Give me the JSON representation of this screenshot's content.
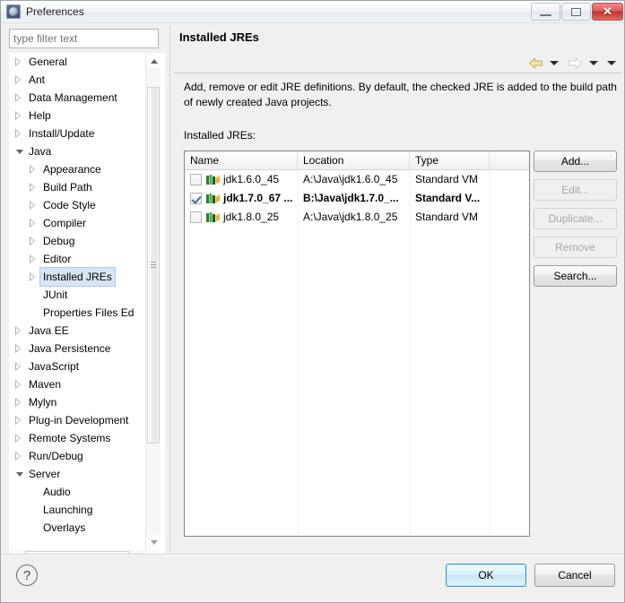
{
  "window": {
    "title": "Preferences",
    "icon": "preferences-app-icon",
    "controls": {
      "minimize": "minimize-button",
      "maximize": "maximize-button",
      "close_glyph": "✕"
    }
  },
  "filter": {
    "placeholder": "type filter text",
    "value": ""
  },
  "tree": {
    "items": [
      {
        "label": "General",
        "indent": 0,
        "state": "collapsed"
      },
      {
        "label": "Ant",
        "indent": 0,
        "state": "collapsed"
      },
      {
        "label": "Data Management",
        "indent": 0,
        "state": "collapsed"
      },
      {
        "label": "Help",
        "indent": 0,
        "state": "collapsed"
      },
      {
        "label": "Install/Update",
        "indent": 0,
        "state": "collapsed"
      },
      {
        "label": "Java",
        "indent": 0,
        "state": "expanded"
      },
      {
        "label": "Appearance",
        "indent": 1,
        "state": "collapsed"
      },
      {
        "label": "Build Path",
        "indent": 1,
        "state": "collapsed"
      },
      {
        "label": "Code Style",
        "indent": 1,
        "state": "collapsed"
      },
      {
        "label": "Compiler",
        "indent": 1,
        "state": "collapsed"
      },
      {
        "label": "Debug",
        "indent": 1,
        "state": "collapsed"
      },
      {
        "label": "Editor",
        "indent": 1,
        "state": "collapsed"
      },
      {
        "label": "Installed JREs",
        "indent": 1,
        "state": "collapsed",
        "selected": true
      },
      {
        "label": "JUnit",
        "indent": 1,
        "state": "leaf"
      },
      {
        "label": "Properties Files Ed",
        "indent": 1,
        "state": "leaf"
      },
      {
        "label": "Java EE",
        "indent": 0,
        "state": "collapsed"
      },
      {
        "label": "Java Persistence",
        "indent": 0,
        "state": "collapsed"
      },
      {
        "label": "JavaScript",
        "indent": 0,
        "state": "collapsed"
      },
      {
        "label": "Maven",
        "indent": 0,
        "state": "collapsed"
      },
      {
        "label": "Mylyn",
        "indent": 0,
        "state": "collapsed"
      },
      {
        "label": "Plug-in Development",
        "indent": 0,
        "state": "collapsed"
      },
      {
        "label": "Remote Systems",
        "indent": 0,
        "state": "collapsed"
      },
      {
        "label": "Run/Debug",
        "indent": 0,
        "state": "collapsed"
      },
      {
        "label": "Server",
        "indent": 0,
        "state": "expanded"
      },
      {
        "label": "Audio",
        "indent": 1,
        "state": "leaf"
      },
      {
        "label": "Launching",
        "indent": 1,
        "state": "leaf"
      },
      {
        "label": "Overlays",
        "indent": 1,
        "state": "leaf"
      }
    ]
  },
  "pane": {
    "title": "Installed JREs",
    "description": "Add, remove or edit JRE definitions. By default, the checked JRE is added to the build path of newly created Java projects.",
    "table_label": "Installed JREs:",
    "nav": {
      "back_icon": "arrow-left-icon",
      "back_menu_icon": "chevron-down-icon",
      "forward_icon": "arrow-right-icon",
      "forward_menu_icon": "chevron-down-icon",
      "more_menu_icon": "chevron-down-icon"
    }
  },
  "table": {
    "columns": [
      "Name",
      "Location",
      "Type"
    ],
    "rows": [
      {
        "checked": false,
        "icon": "jre-library-icon",
        "name": "jdk1.6.0_45",
        "location": "A:\\Java\\jdk1.6.0_45",
        "type": "Standard VM"
      },
      {
        "checked": true,
        "icon": "jre-library-icon",
        "name": "jdk1.7.0_67 ...",
        "location": "B:\\Java\\jdk1.7.0_...",
        "type": "Standard V..."
      },
      {
        "checked": false,
        "icon": "jre-library-icon",
        "name": "jdk1.8.0_25",
        "location": "A:\\Java\\jdk1.8.0_25",
        "type": "Standard VM"
      }
    ]
  },
  "side_buttons": [
    {
      "label": "Add...",
      "enabled": true
    },
    {
      "label": "Edit...",
      "enabled": false
    },
    {
      "label": "Duplicate...",
      "enabled": false
    },
    {
      "label": "Remove",
      "enabled": false
    },
    {
      "label": "Search...",
      "enabled": true
    }
  ],
  "footer": {
    "help_icon": "help-question-icon",
    "ok_label": "OK",
    "cancel_label": "Cancel"
  },
  "colors": {
    "accent": "#3c9ad4",
    "selection": "#d6e5f5",
    "close_button": "#c62f30",
    "back_arrow": "#e8c96a"
  }
}
